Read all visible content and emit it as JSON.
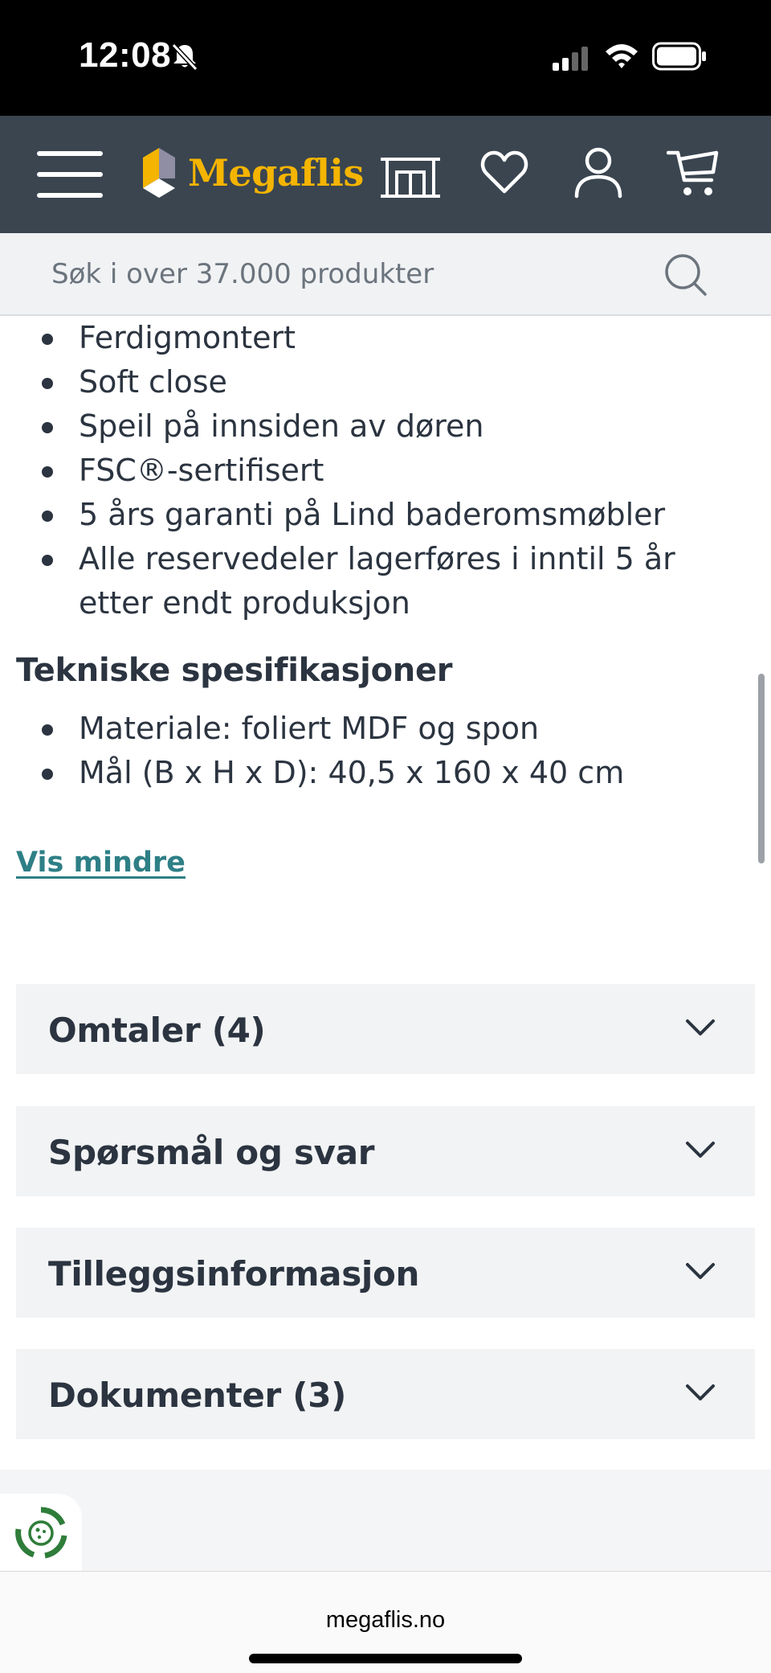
{
  "status_bar": {
    "time": "12:08"
  },
  "header": {
    "brand": "Megaflis",
    "brand_color": "#f4b400",
    "background": "#3a4550",
    "icons": [
      "menu-icon",
      "showroom-icon",
      "heart-icon",
      "user-icon",
      "cart-icon"
    ]
  },
  "search": {
    "placeholder": "Søk i over 37.000 produkter"
  },
  "product_description": {
    "features": [
      "Ferdigmontert",
      "Soft close",
      "Speil på innsiden av døren",
      "FSC®-sertifisert",
      "5 års garanti på Lind baderomsmøbler",
      "Alle reservedeler lagerføres i inntil 5 år etter endt produksjon"
    ],
    "specs_heading": "Tekniske spesifikasjoner",
    "specs": [
      "Materiale: foliert MDF og spon",
      "Mål (B x H x D): 40,5 x 160 x 40 cm"
    ],
    "toggle_label": "Vis mindre",
    "link_color": "#2e7f86"
  },
  "accordions": [
    {
      "title": "Omtaler (4)"
    },
    {
      "title": "Spørsmål og svar"
    },
    {
      "title": "Tilleggsinformasjon"
    },
    {
      "title": "Dokumenter (3)"
    }
  ],
  "browser": {
    "url": "megaflis.no"
  }
}
